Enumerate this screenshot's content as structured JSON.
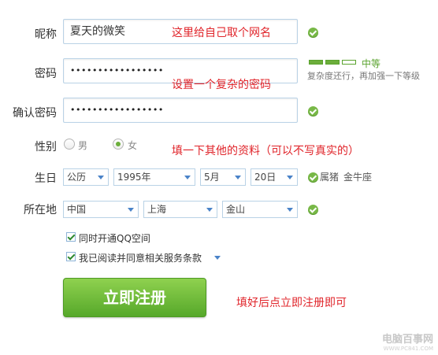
{
  "form": {
    "nickname": {
      "label": "昵称",
      "value": "夏天的微笑",
      "note": "这里给自己取个网名"
    },
    "password": {
      "label": "密码",
      "value": "•••••••••••••••••",
      "note": "设置一个复杂的密码",
      "strength": {
        "level_label": "中等",
        "level": 2,
        "segments": 3,
        "hint": "复杂度还行，再加强一下等级"
      }
    },
    "confirm": {
      "label": "确认密码",
      "value": "•••••••••••••••••"
    },
    "gender": {
      "label": "性别",
      "options": [
        "男",
        "女"
      ],
      "selected": "女"
    },
    "birthday": {
      "label": "生日",
      "calendar": "公历",
      "year": "1995年",
      "month": "5月",
      "day": "20日",
      "zodiac": "属猪",
      "constellation": "金牛座"
    },
    "location": {
      "label": "所在地",
      "country": "中国",
      "province": "上海",
      "district": "金山"
    },
    "notes": {
      "other_info": "填一下其他的资料（可以不写真实的）",
      "submit_hint": "填好后点立即注册即可"
    },
    "options": {
      "qq_space": {
        "label": "同时开通QQ空间",
        "checked": true
      },
      "agreement": {
        "label": "我已阅读并同意相关服务条款",
        "checked": true
      }
    },
    "submit_label": "立即注册"
  },
  "watermark": {
    "name": "电脑百事网",
    "url": "WWW.PC841.COM"
  },
  "colors": {
    "accent_green": "#6cae3b",
    "note_red": "#e0242a",
    "input_border": "#b9d2e6"
  }
}
